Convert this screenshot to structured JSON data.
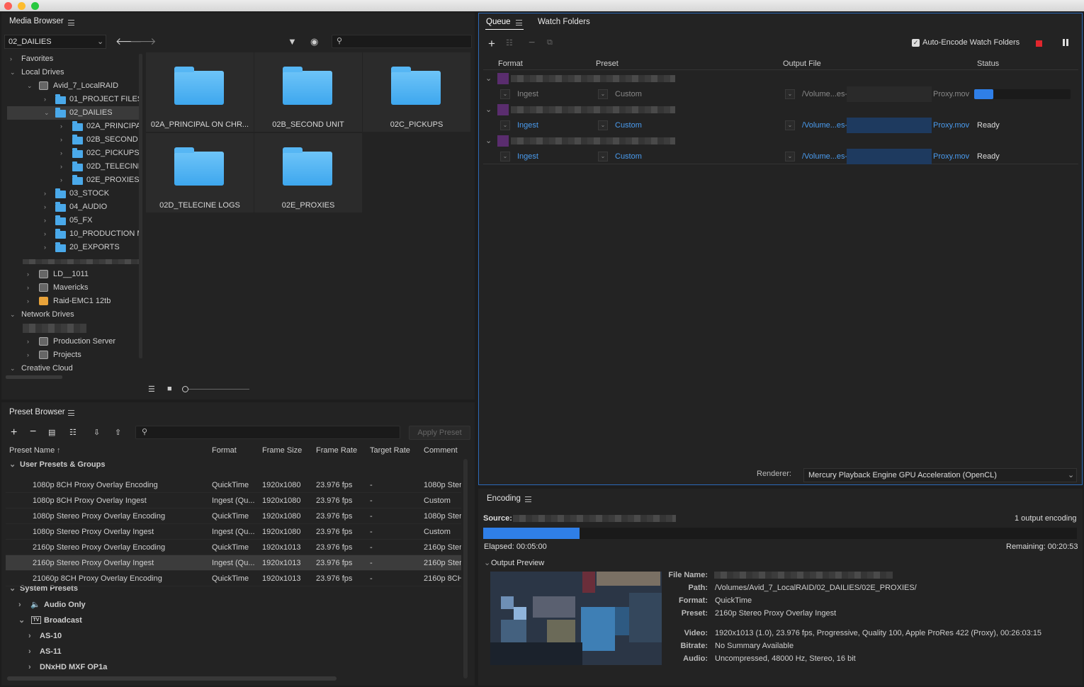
{
  "media_browser": {
    "title": "Media Browser",
    "location": "02_DAILIES",
    "tree": {
      "favorites": "Favorites",
      "local_drives": "Local Drives",
      "avid": "Avid_7_LocalRAID",
      "project_files": "01_PROJECT FILES",
      "dailies": "02_DAILIES",
      "principal": "02A_PRINCIPA",
      "second": "02B_SECOND I",
      "pickups": "02C_PICKUPS",
      "telecine": "02D_TELECINE",
      "proxies": "02E_PROXIES",
      "stock": "03_STOCK",
      "audio": "04_AUDIO",
      "fx": "05_FX",
      "production": "10_PRODUCTION M",
      "exports": "20_EXPORTS",
      "ld": "LD__1011",
      "mavericks": "Mavericks",
      "raid": "Raid-EMC1 12tb",
      "network_drives": "Network Drives",
      "production_server": "Production Server",
      "projects": "Projects",
      "creative_cloud": "Creative Cloud"
    },
    "tiles": [
      "02A_PRINCIPAL ON CHR...",
      "02B_SECOND UNIT",
      "02C_PICKUPS",
      "02D_TELECINE LOGS",
      "02E_PROXIES"
    ]
  },
  "preset_browser": {
    "title": "Preset Browser",
    "apply_label": "Apply Preset",
    "columns": [
      "Preset Name",
      "Format",
      "Frame Size",
      "Frame Rate",
      "Target Rate",
      "Comment"
    ],
    "user_group": "User Presets & Groups",
    "rows": [
      {
        "name": "1080p 8CH Proxy Overlay Encoding",
        "format": "QuickTime",
        "size": "1920x1080",
        "rate": "23.976 fps",
        "target": "-",
        "comment": "1080p Steri"
      },
      {
        "name": "1080p 8CH Proxy Overlay Ingest",
        "format": "Ingest (Qu...",
        "size": "1920x1080",
        "rate": "23.976 fps",
        "target": "-",
        "comment": "Custom"
      },
      {
        "name": "1080p Stereo Proxy Overlay Encoding",
        "format": "QuickTime",
        "size": "1920x1080",
        "rate": "23.976 fps",
        "target": "-",
        "comment": "1080p Steri"
      },
      {
        "name": "1080p Stereo Proxy Overlay Ingest",
        "format": "Ingest (Qu...",
        "size": "1920x1080",
        "rate": "23.976 fps",
        "target": "-",
        "comment": "Custom"
      },
      {
        "name": "2160p Stereo Proxy Overlay Encoding",
        "format": "QuickTime",
        "size": "1920x1013",
        "rate": "23.976 fps",
        "target": "-",
        "comment": "2160p Steri"
      },
      {
        "name": "2160p Stereo Proxy Overlay Ingest",
        "format": "Ingest (Qu...",
        "size": "1920x1013",
        "rate": "23.976 fps",
        "target": "-",
        "comment": "2160p Steri"
      },
      {
        "name": "21060p 8CH Proxy Overlay Encoding",
        "format": "QuickTime",
        "size": "1920x1013",
        "rate": "23.976 fps",
        "target": "-",
        "comment": "2160p 8CH"
      }
    ],
    "system_group": "System Presets",
    "system_items": [
      "Audio Only",
      "Broadcast",
      "AS-10",
      "AS-11",
      "DNxHD MXF OP1a"
    ]
  },
  "queue": {
    "tab_queue": "Queue",
    "tab_watch": "Watch Folders",
    "auto_encode": "Auto-Encode Watch Folders",
    "columns": [
      "Format",
      "Preset",
      "Output File",
      "Status"
    ],
    "items": [
      {
        "format": "Ingest",
        "preset": "Custom",
        "path": "/Volume...es-",
        "file": "Proxy.mov",
        "status": "",
        "progress": 0.2
      },
      {
        "format": "Ingest",
        "preset": "Custom",
        "path": "/Volume...es-",
        "file": "Proxy.mov",
        "status": "Ready"
      },
      {
        "format": "Ingest",
        "preset": "Custom",
        "path": "/Volume...es-",
        "file": "Proxy.mov",
        "status": "Ready"
      }
    ],
    "renderer_label": "Renderer:",
    "renderer_value": "Mercury Playback Engine GPU Acceleration (OpenCL)"
  },
  "encoding": {
    "title": "Encoding",
    "source_label": "Source:",
    "outputs": "1 output encoding",
    "elapsed": "Elapsed: 00:05:00",
    "remaining": "Remaining: 00:20:53",
    "progress": 0.22,
    "output_preview": "Output Preview",
    "labels": {
      "file_name": "File Name:",
      "path": "Path:",
      "format": "Format:",
      "preset": "Preset:",
      "video": "Video:",
      "bitrate": "Bitrate:",
      "audio": "Audio:"
    },
    "path": "/Volumes/Avid_7_LocalRAID/02_DAILIES/02E_PROXIES/",
    "format": "QuickTime",
    "preset": "2160p Stereo Proxy Overlay Ingest",
    "video": "1920x1013 (1.0), 23.976 fps, Progressive, Quality 100, Apple ProRes 422 (Proxy), 00:26:03:15",
    "bitrate": "No Summary Available",
    "audio": "Uncompressed, 48000 Hz, Stereo, 16 bit"
  },
  "colors": {
    "accent": "#4a9cf0",
    "folder": "#4aa9ea",
    "stop": "#e0262d"
  }
}
